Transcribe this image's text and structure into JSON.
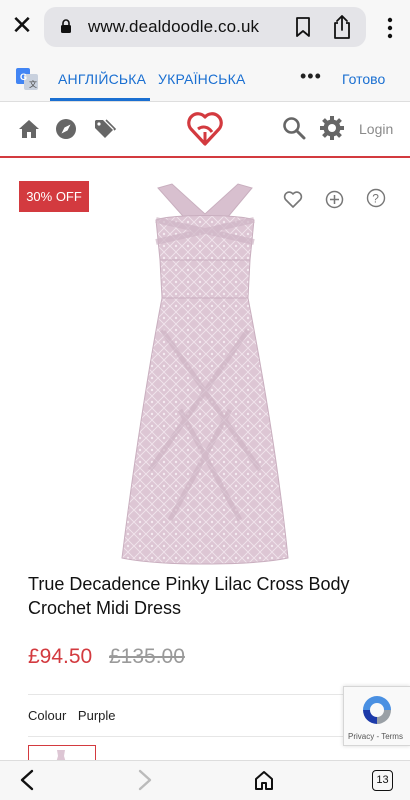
{
  "browser": {
    "url": "www.dealdoodle.co.uk",
    "close_icon": "close-icon",
    "tab_count": "13"
  },
  "translate": {
    "source_lang": "АНГЛІЙСЬКА",
    "target_lang": "УКРАЇНСЬКА",
    "more": "•••",
    "done": "Готово"
  },
  "header": {
    "login": "Login",
    "accent": "#d33a3f"
  },
  "product": {
    "badge": "30% OFF",
    "title": "True Decadence Pinky Lilac Cross Body Crochet Midi Dress",
    "price": "£94.50",
    "old_price": "£135.00",
    "colour_label": "Colour",
    "colour_value": "Purple",
    "dress_color": "#ddc6d4"
  },
  "recaptcha": {
    "links": "Privacy - Terms"
  }
}
